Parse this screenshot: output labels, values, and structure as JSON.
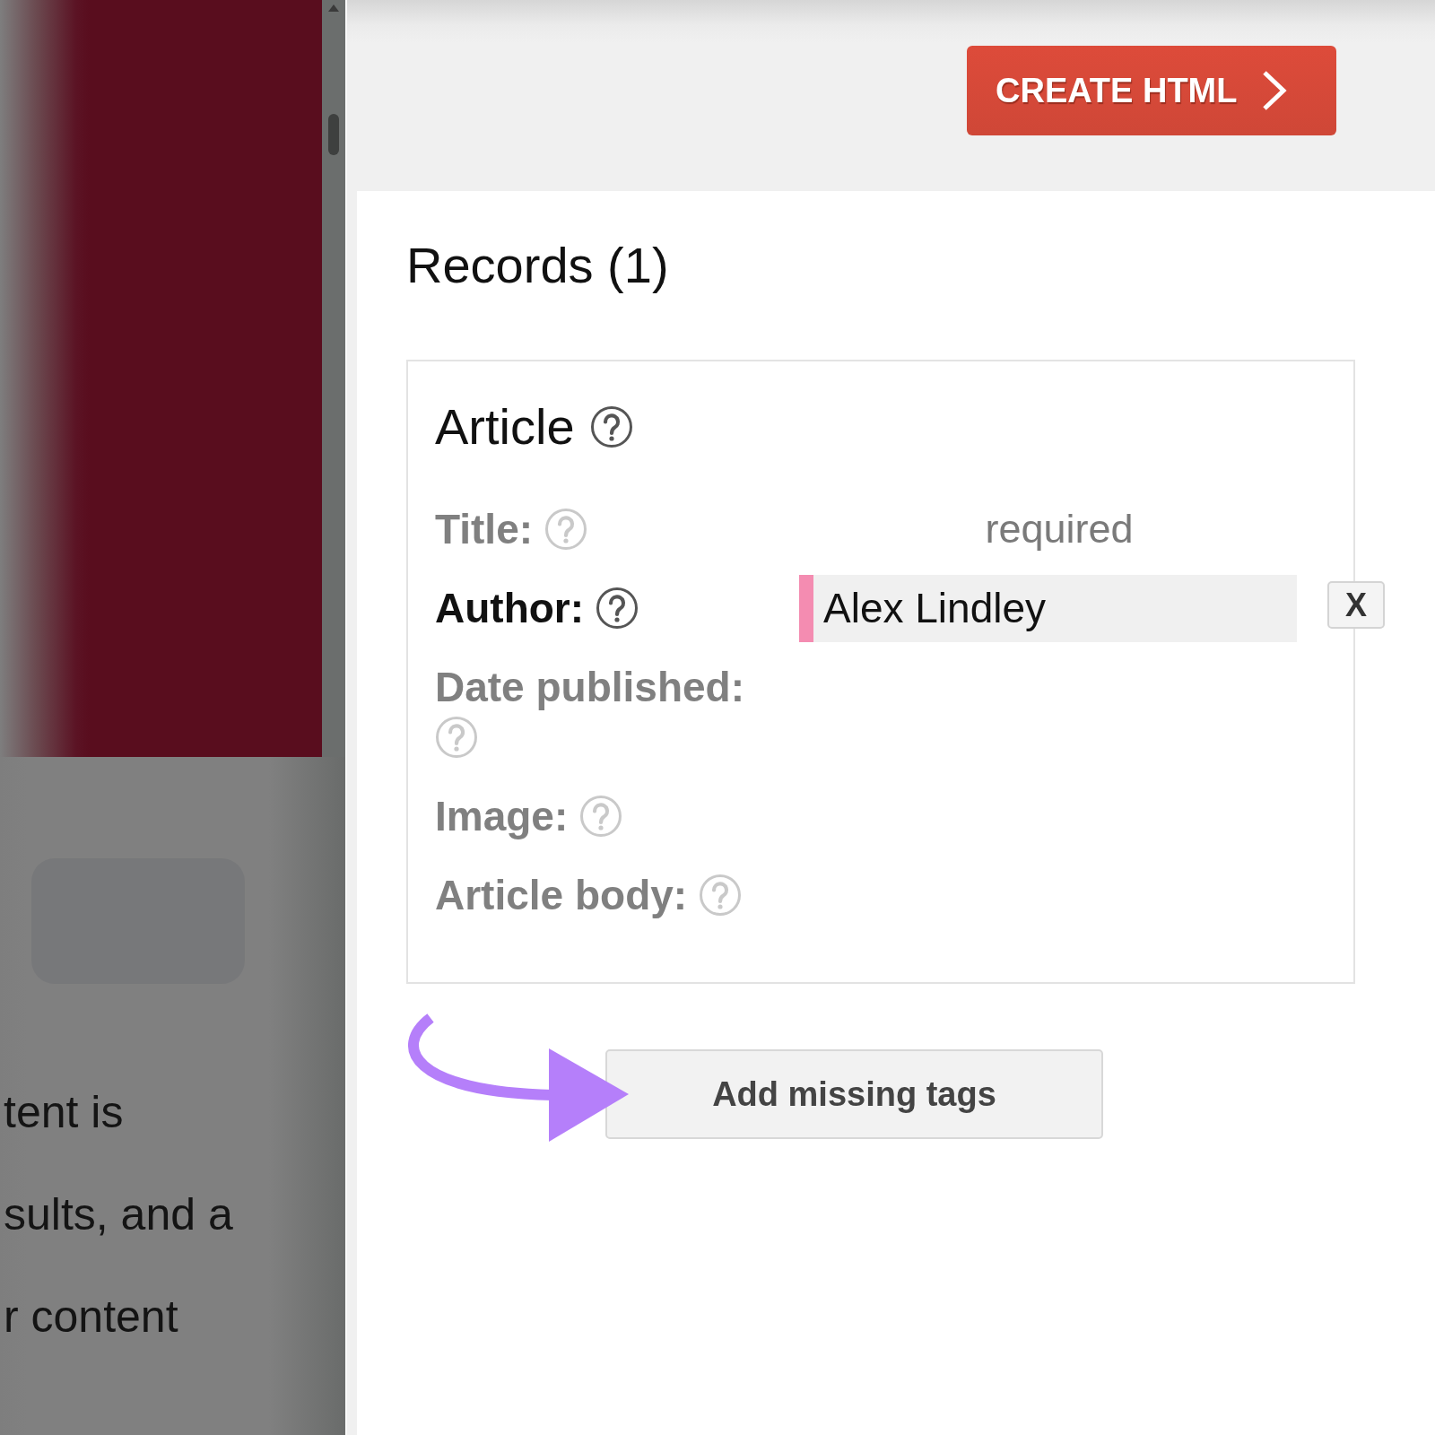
{
  "dimmed_page": {
    "text_lines": [
      "tent is",
      "sults, and a",
      "r content"
    ]
  },
  "header": {
    "create_button": "CREATE HTML"
  },
  "records": {
    "title": "Records (1)",
    "items": [
      {
        "type": "Article",
        "fields": [
          {
            "label": "Title:",
            "filled": false,
            "note": "required"
          },
          {
            "label": "Author:",
            "filled": true,
            "value": "Alex Lindley",
            "remove_button": "X"
          },
          {
            "label": "Date published:",
            "filled": false
          },
          {
            "label": "Image:",
            "filled": false
          },
          {
            "label": "Article body:",
            "filled": false
          }
        ]
      }
    ]
  },
  "add_missing_tags_button": "Add missing tags"
}
